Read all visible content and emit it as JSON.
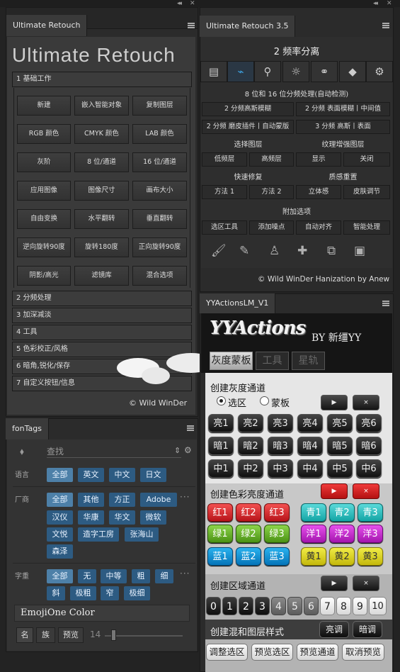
{
  "left_panel": {
    "tab": "Ultimate Retouch",
    "big_title": "Ultimate Retouch",
    "section1": "1 基础工作",
    "buttons": [
      "新建",
      "嵌入智能对象",
      "复制图层",
      "RGB 颜色",
      "CMYK 颜色",
      "LAB 颜色",
      "灰阶",
      "8 位/通道",
      "16 位/通道",
      "应用图像",
      "图像尺寸",
      "画布大小",
      "自由变换",
      "水平翻转",
      "垂直翻转",
      "逆向旋转90度",
      "旋转180度",
      "正向旋转90度",
      "阴影/高光",
      "滤镜库",
      "混合选项"
    ],
    "sections": [
      "2 分频处理",
      "3 加深减淡",
      "4 工具",
      "5 色彩校正/风格",
      "6 暗角,锐化/保存",
      "7 自定义按钮/信息"
    ],
    "credit": "© Wild WinDer"
  },
  "right_panel": {
    "tab": "Ultimate Retouch 3.5",
    "heading": "2 频率分离",
    "icons": [
      "document-icon",
      "waveform-icon",
      "search-icon",
      "brightness-icon",
      "rgb-circles-icon",
      "diamond-icon",
      "gears-icon"
    ],
    "subheading": "8 位和 16 位分频处理(自动检测)",
    "row1": [
      "2 分频高斯模糊",
      "2 分频 表面模糊丨中间值"
    ],
    "row2": [
      "2 分频 磨皮插件丨自动蒙版",
      "3 分频 高斯丨表面"
    ],
    "label_select": "选择图层",
    "label_texture": "纹理增强图层",
    "row3": [
      "低频层",
      "高频层",
      "显示",
      "关闭"
    ],
    "label_quick": "快速修复",
    "label_texture_reset": "质感重置",
    "row4": [
      "方法 1",
      "方法 2",
      "立体感",
      "皮肤调节"
    ],
    "label_extra": "附加选项",
    "row5": [
      "选区工具",
      "添加噪点",
      "自动对齐",
      "智能处理"
    ],
    "tools": [
      "brush-icon",
      "mixer-brush-icon",
      "stamp-icon",
      "bandage-icon",
      "patch-icon",
      "chip-icon"
    ],
    "credit": "© Wild WinDer Hanization by Anew"
  },
  "fontags": {
    "tab": "fonTags",
    "search_placeholder": "查找",
    "lang_label": "语言",
    "lang_tags": [
      "全部",
      "英文",
      "中文",
      "日文"
    ],
    "vendor_label": "厂商",
    "vendor_tags": [
      "全部",
      "其他",
      "方正",
      "Adobe",
      "汉仪",
      "华康",
      "华文",
      "微软",
      "文悦",
      "造字工房",
      "张海山",
      "森泽"
    ],
    "weight_label": "字重",
    "weight_tags": [
      "全部",
      "无",
      "中等",
      "粗",
      "细",
      "斜",
      "极粗",
      "窄",
      "极细"
    ],
    "font_name": "EmojiOne Color",
    "bottom_tabs": [
      "名",
      "族",
      "预览"
    ],
    "size": "14"
  },
  "yyactions": {
    "tab": "YYActionsLM_V1",
    "logo": "YYActions",
    "by": "BY 新缰YY",
    "tabs": [
      "灰度蒙板",
      "工具",
      "星轨"
    ],
    "gray_title": "创建灰度通道",
    "radio_selection": "选区",
    "radio_mask": "蒙板",
    "play": "▶",
    "close": "×",
    "gray_rows": [
      [
        "亮1",
        "亮2",
        "亮3",
        "亮4",
        "亮5",
        "亮6"
      ],
      [
        "暗1",
        "暗2",
        "暗3",
        "暗4",
        "暗5",
        "暗6"
      ],
      [
        "中1",
        "中2",
        "中3",
        "中4",
        "中5",
        "中6"
      ]
    ],
    "color_title": "创建色彩亮度通道",
    "color_left": [
      [
        "红1",
        "红2",
        "红3"
      ],
      [
        "绿1",
        "绿2",
        "绿3"
      ],
      [
        "蓝1",
        "蓝2",
        "蓝3"
      ]
    ],
    "color_right": [
      [
        "青1",
        "青2",
        "青3"
      ],
      [
        "洋1",
        "洋2",
        "洋3"
      ],
      [
        "黄1",
        "黄2",
        "黄3"
      ]
    ],
    "zone_title": "创建区域通道",
    "zones": [
      "0",
      "1",
      "2",
      "3",
      "4",
      "5",
      "6",
      "7",
      "8",
      "9",
      "10"
    ],
    "blend_title": "创建混和图层样式",
    "blend_buttons": [
      "亮调",
      "暗调"
    ],
    "bottom_buttons": [
      "调整选区",
      "预览选区",
      "预览通道",
      "取消预览"
    ]
  }
}
